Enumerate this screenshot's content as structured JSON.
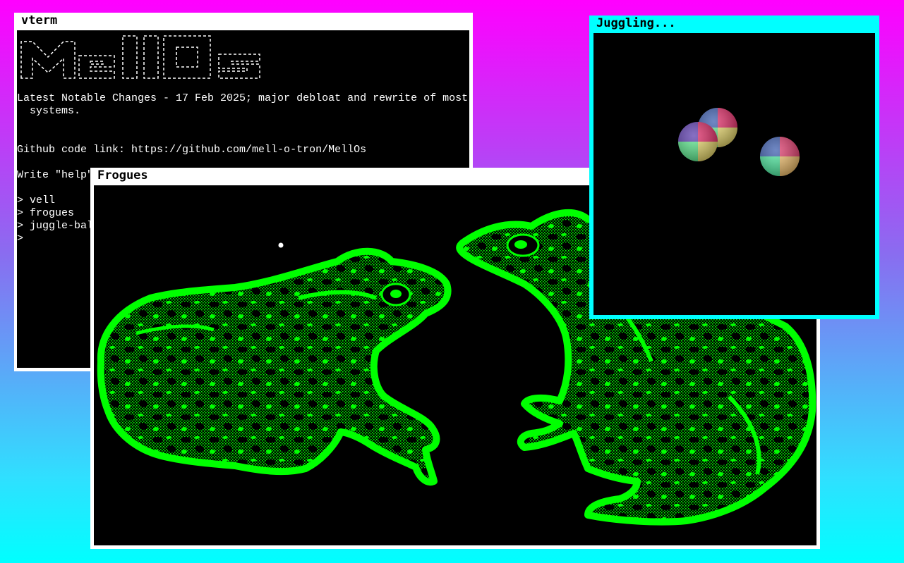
{
  "vterm": {
    "title": "vterm",
    "logo_text": "MellOs",
    "changes_line1": "Latest Notable Changes - 17 Feb 2025; major debloat and rewrite of most",
    "changes_line2": "  systems.",
    "github_line": "Github code link: https://github.com/mell-o-tron/MellOs",
    "help_line": "Write \"help\" for a list of commands.",
    "history": [
      "> vell",
      "> frogues",
      "> juggle-balls",
      ">"
    ]
  },
  "frogues": {
    "title": "Frogues",
    "frog_color": "#00ff00",
    "dot_color": "#ffffff"
  },
  "juggling": {
    "title": "Juggling...",
    "border_color": "#00ffff"
  },
  "desktop": {
    "gradient_top": "#ff00ff",
    "gradient_bottom": "#00ffff"
  }
}
